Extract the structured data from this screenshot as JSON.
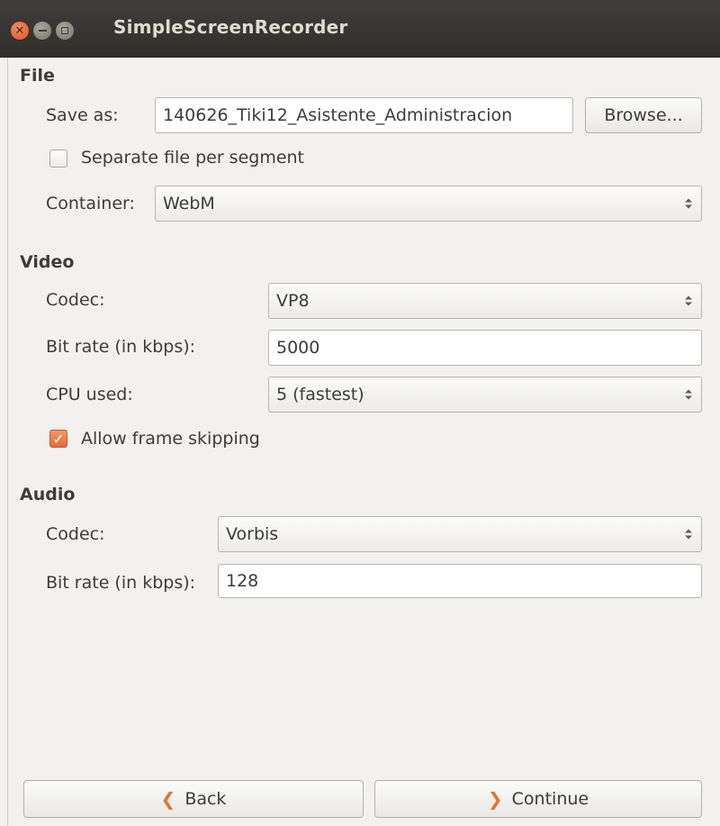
{
  "window": {
    "title": "SimpleScreenRecorder"
  },
  "file": {
    "heading": "File",
    "save_as_label": "Save as:",
    "save_as_value": "140626_Tiki12_Asistente_Administracion",
    "browse_label": "Browse...",
    "separate_label": "Separate file per segment",
    "separate_checked": false,
    "container_label": "Container:",
    "container_value": "WebM"
  },
  "video": {
    "heading": "Video",
    "codec_label": "Codec:",
    "codec_value": "VP8",
    "bitrate_label": "Bit rate (in kbps):",
    "bitrate_value": "5000",
    "cpu_label": "CPU used:",
    "cpu_value": "5 (fastest)",
    "skip_label": "Allow frame skipping",
    "skip_checked": true
  },
  "audio": {
    "heading": "Audio",
    "codec_label": "Codec:",
    "codec_value": "Vorbis",
    "bitrate_label": "Bit rate (in kbps):",
    "bitrate_value": "128"
  },
  "nav": {
    "back_label": "Back",
    "continue_label": "Continue"
  },
  "icons": {
    "back": "chevron-left-icon",
    "continue": "chevron-right-icon"
  },
  "colors": {
    "accent": "#e7693a",
    "titlebar": "#3a3935"
  }
}
